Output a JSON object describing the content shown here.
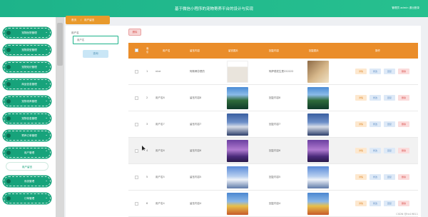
{
  "header": {
    "title": "基于微信小程序的宠物寄养平台的设计与实现",
    "user_text": "管理员 admin   退出登录"
  },
  "sidebar": {
    "items": [
      {
        "label": "宠物医院管理"
      },
      {
        "label": "宠物类型管理"
      },
      {
        "label": "宠物知识管理"
      },
      {
        "label": "商品信息管理"
      },
      {
        "label": "宠物领养管理"
      },
      {
        "label": "宠物信息管理"
      },
      {
        "label": "寄养订单管理"
      },
      {
        "label": "用户管理"
      },
      {
        "label": "系统管理"
      },
      {
        "label": "订单管理"
      }
    ],
    "active_sub": "用户留言"
  },
  "breadcrumb": {
    "home": "首页",
    "sep": "/",
    "current": "用户留言"
  },
  "search": {
    "label": "用户名",
    "placeholder": "用户名",
    "button": "查询"
  },
  "toolbar": {
    "delete_label": "删除"
  },
  "table": {
    "columns": [
      "索引",
      "用户名",
      "留言内容",
      "留言图片",
      "回复内容",
      "回复图片",
      "操作"
    ],
    "actions": {
      "detail": "详情",
      "edit": "修改",
      "review": "回复",
      "delete": "删除"
    },
    "rows": [
      {
        "index": "1",
        "username": "nice",
        "content": "阿斯蒂芬是的",
        "reply": "阿萨德发生是222222",
        "img": "bag",
        "reply_img": "box"
      },
      {
        "index": "2",
        "username": "用户名8",
        "content": "留言内容8",
        "reply": "回复内容8",
        "img": "waterfall",
        "reply_img": "waterfall"
      },
      {
        "index": "3",
        "username": "用户名7",
        "content": "留言内容7",
        "reply": "回复内容7",
        "img": "mountain",
        "reply_img": "mountain"
      },
      {
        "index": "4",
        "username": "用户名6",
        "content": "留言内容6",
        "reply": "回复内容6",
        "img": "purple",
        "reply_img": "purple"
      },
      {
        "index": "5",
        "username": "用户名5",
        "content": "留言内容5",
        "reply": "回复内容5",
        "img": "snowpeak",
        "reply_img": "snowpeak"
      },
      {
        "index": "6",
        "username": "用户名4",
        "content": "留言内容4",
        "reply": "回复内容4",
        "img": "field",
        "reply_img": "field"
      }
    ]
  },
  "watermark": "CSDN @hk19811"
}
